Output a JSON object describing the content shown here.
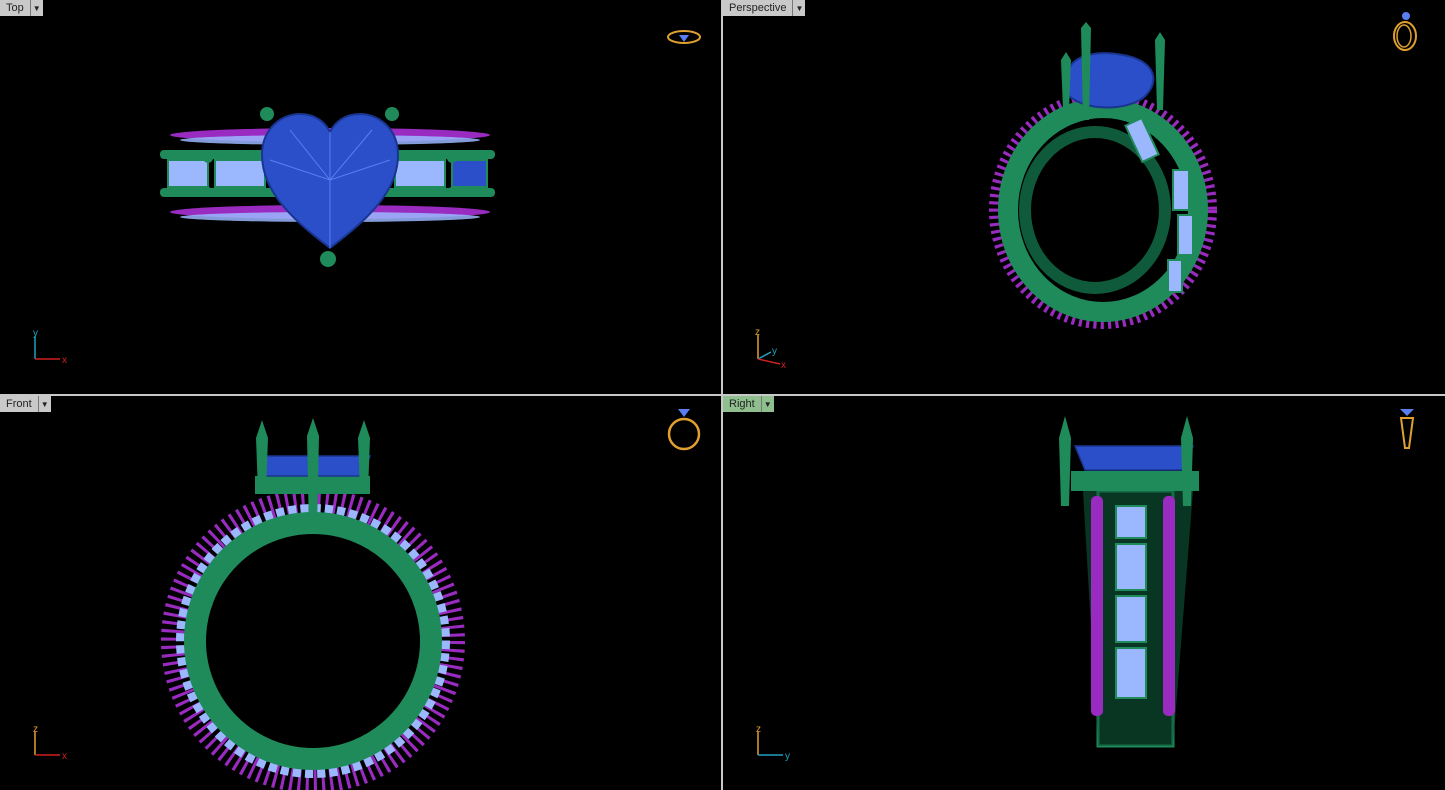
{
  "viewports": {
    "top": {
      "label": "Top",
      "axes": {
        "a": "y",
        "b": "x"
      }
    },
    "perspective": {
      "label": "Perspective",
      "axes": {
        "a": "z",
        "b": "y",
        "c": "x"
      }
    },
    "front": {
      "label": "Front",
      "axes": {
        "a": "z",
        "b": "x"
      }
    },
    "right": {
      "label": "Right",
      "axes": {
        "a": "z",
        "b": "y"
      }
    }
  },
  "colors": {
    "metal": "#1f8a5a",
    "metal_dark": "#0f5a3a",
    "gem": "#2a4fc9",
    "baguette": "#9bb8ff",
    "pave": "#9a2bc0",
    "axis_x": "#d02020",
    "axis_y": "#20a0c0",
    "axis_z": "#e0a030",
    "active_tab": "#8fbf8f"
  },
  "icons": [
    "view-cube-icon",
    "dropdown-arrow-icon"
  ]
}
